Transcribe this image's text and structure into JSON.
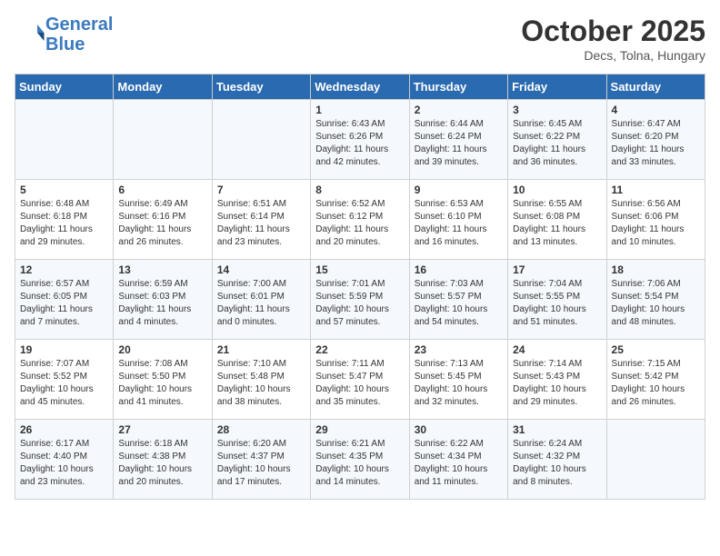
{
  "header": {
    "logo_line1": "General",
    "logo_line2": "Blue",
    "month": "October 2025",
    "location": "Decs, Tolna, Hungary"
  },
  "weekdays": [
    "Sunday",
    "Monday",
    "Tuesday",
    "Wednesday",
    "Thursday",
    "Friday",
    "Saturday"
  ],
  "weeks": [
    [
      {
        "day": "",
        "content": ""
      },
      {
        "day": "",
        "content": ""
      },
      {
        "day": "",
        "content": ""
      },
      {
        "day": "1",
        "content": "Sunrise: 6:43 AM\nSunset: 6:26 PM\nDaylight: 11 hours\nand 42 minutes."
      },
      {
        "day": "2",
        "content": "Sunrise: 6:44 AM\nSunset: 6:24 PM\nDaylight: 11 hours\nand 39 minutes."
      },
      {
        "day": "3",
        "content": "Sunrise: 6:45 AM\nSunset: 6:22 PM\nDaylight: 11 hours\nand 36 minutes."
      },
      {
        "day": "4",
        "content": "Sunrise: 6:47 AM\nSunset: 6:20 PM\nDaylight: 11 hours\nand 33 minutes."
      }
    ],
    [
      {
        "day": "5",
        "content": "Sunrise: 6:48 AM\nSunset: 6:18 PM\nDaylight: 11 hours\nand 29 minutes."
      },
      {
        "day": "6",
        "content": "Sunrise: 6:49 AM\nSunset: 6:16 PM\nDaylight: 11 hours\nand 26 minutes."
      },
      {
        "day": "7",
        "content": "Sunrise: 6:51 AM\nSunset: 6:14 PM\nDaylight: 11 hours\nand 23 minutes."
      },
      {
        "day": "8",
        "content": "Sunrise: 6:52 AM\nSunset: 6:12 PM\nDaylight: 11 hours\nand 20 minutes."
      },
      {
        "day": "9",
        "content": "Sunrise: 6:53 AM\nSunset: 6:10 PM\nDaylight: 11 hours\nand 16 minutes."
      },
      {
        "day": "10",
        "content": "Sunrise: 6:55 AM\nSunset: 6:08 PM\nDaylight: 11 hours\nand 13 minutes."
      },
      {
        "day": "11",
        "content": "Sunrise: 6:56 AM\nSunset: 6:06 PM\nDaylight: 11 hours\nand 10 minutes."
      }
    ],
    [
      {
        "day": "12",
        "content": "Sunrise: 6:57 AM\nSunset: 6:05 PM\nDaylight: 11 hours\nand 7 minutes."
      },
      {
        "day": "13",
        "content": "Sunrise: 6:59 AM\nSunset: 6:03 PM\nDaylight: 11 hours\nand 4 minutes."
      },
      {
        "day": "14",
        "content": "Sunrise: 7:00 AM\nSunset: 6:01 PM\nDaylight: 11 hours\nand 0 minutes."
      },
      {
        "day": "15",
        "content": "Sunrise: 7:01 AM\nSunset: 5:59 PM\nDaylight: 10 hours\nand 57 minutes."
      },
      {
        "day": "16",
        "content": "Sunrise: 7:03 AM\nSunset: 5:57 PM\nDaylight: 10 hours\nand 54 minutes."
      },
      {
        "day": "17",
        "content": "Sunrise: 7:04 AM\nSunset: 5:55 PM\nDaylight: 10 hours\nand 51 minutes."
      },
      {
        "day": "18",
        "content": "Sunrise: 7:06 AM\nSunset: 5:54 PM\nDaylight: 10 hours\nand 48 minutes."
      }
    ],
    [
      {
        "day": "19",
        "content": "Sunrise: 7:07 AM\nSunset: 5:52 PM\nDaylight: 10 hours\nand 45 minutes."
      },
      {
        "day": "20",
        "content": "Sunrise: 7:08 AM\nSunset: 5:50 PM\nDaylight: 10 hours\nand 41 minutes."
      },
      {
        "day": "21",
        "content": "Sunrise: 7:10 AM\nSunset: 5:48 PM\nDaylight: 10 hours\nand 38 minutes."
      },
      {
        "day": "22",
        "content": "Sunrise: 7:11 AM\nSunset: 5:47 PM\nDaylight: 10 hours\nand 35 minutes."
      },
      {
        "day": "23",
        "content": "Sunrise: 7:13 AM\nSunset: 5:45 PM\nDaylight: 10 hours\nand 32 minutes."
      },
      {
        "day": "24",
        "content": "Sunrise: 7:14 AM\nSunset: 5:43 PM\nDaylight: 10 hours\nand 29 minutes."
      },
      {
        "day": "25",
        "content": "Sunrise: 7:15 AM\nSunset: 5:42 PM\nDaylight: 10 hours\nand 26 minutes."
      }
    ],
    [
      {
        "day": "26",
        "content": "Sunrise: 6:17 AM\nSunset: 4:40 PM\nDaylight: 10 hours\nand 23 minutes."
      },
      {
        "day": "27",
        "content": "Sunrise: 6:18 AM\nSunset: 4:38 PM\nDaylight: 10 hours\nand 20 minutes."
      },
      {
        "day": "28",
        "content": "Sunrise: 6:20 AM\nSunset: 4:37 PM\nDaylight: 10 hours\nand 17 minutes."
      },
      {
        "day": "29",
        "content": "Sunrise: 6:21 AM\nSunset: 4:35 PM\nDaylight: 10 hours\nand 14 minutes."
      },
      {
        "day": "30",
        "content": "Sunrise: 6:22 AM\nSunset: 4:34 PM\nDaylight: 10 hours\nand 11 minutes."
      },
      {
        "day": "31",
        "content": "Sunrise: 6:24 AM\nSunset: 4:32 PM\nDaylight: 10 hours\nand 8 minutes."
      },
      {
        "day": "",
        "content": ""
      }
    ]
  ]
}
